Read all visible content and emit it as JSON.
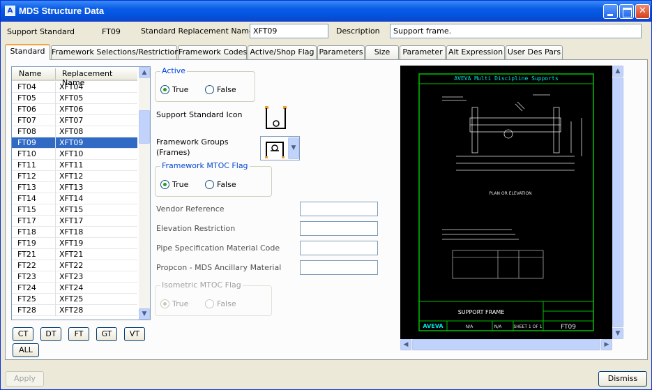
{
  "window": {
    "title": "MDS Structure Data"
  },
  "header": {
    "support_standard_label": "Support Standard",
    "support_standard_value": "FT09",
    "replacement_name_label": "Standard Replacement Name",
    "replacement_name_value": "XFT09",
    "description_label": "Description",
    "description_value": "Support frame."
  },
  "tabs": [
    "Standard",
    "Framework Selections/Restrictions",
    "Framework Codes",
    "Active/Shop Flag",
    "Parameters",
    "Size",
    "Parameter",
    "Alt Expression",
    "User Des Pars"
  ],
  "list": {
    "col_name": "Name",
    "col_replacement": "Replacement Name",
    "rows": [
      {
        "name": "FT04",
        "rep": "XFT04"
      },
      {
        "name": "FT05",
        "rep": "XFT05"
      },
      {
        "name": "FT06",
        "rep": "XFT06"
      },
      {
        "name": "FT07",
        "rep": "XFT07"
      },
      {
        "name": "FT08",
        "rep": "XFT08"
      },
      {
        "name": "FT09",
        "rep": "XFT09"
      },
      {
        "name": "FT10",
        "rep": "XFT10"
      },
      {
        "name": "FT11",
        "rep": "XFT11"
      },
      {
        "name": "FT12",
        "rep": "XFT12"
      },
      {
        "name": "FT13",
        "rep": "XFT13"
      },
      {
        "name": "FT14",
        "rep": "XFT14"
      },
      {
        "name": "FT15",
        "rep": "XFT15"
      },
      {
        "name": "FT17",
        "rep": "XFT17"
      },
      {
        "name": "FT18",
        "rep": "XFT18"
      },
      {
        "name": "FT19",
        "rep": "XFT19"
      },
      {
        "name": "FT21",
        "rep": "XFT21"
      },
      {
        "name": "FT22",
        "rep": "XFT22"
      },
      {
        "name": "FT23",
        "rep": "XFT23"
      },
      {
        "name": "FT24",
        "rep": "XFT24"
      },
      {
        "name": "FT25",
        "rep": "XFT25"
      },
      {
        "name": "FT28",
        "rep": "XFT28"
      }
    ]
  },
  "filter_buttons": [
    "CT",
    "DT",
    "FT",
    "GT",
    "VT",
    "ALL"
  ],
  "active": {
    "title": "Active",
    "true_label": "True",
    "false_label": "False"
  },
  "icon_label": "Support Standard Icon",
  "framework_groups_label": "Framework Groups\n(Frames)",
  "mtoc": {
    "title": "Framework MTOC Flag",
    "true_label": "True",
    "false_label": "False"
  },
  "fields": {
    "vendor": "Vendor Reference",
    "elevation": "Elevation Restriction",
    "pipe_spec": "Pipe Specification Material Code",
    "propcon": "Propcon - MDS Ancillary Material"
  },
  "iso": {
    "title": "Isometric MTOC Flag",
    "true_label": "True",
    "false_label": "False"
  },
  "drawing": {
    "banner": "AVEVA Multi Discipline Supports",
    "view_title": "PLAN OR ELEVATION",
    "title_block": "SUPPORT FRAME",
    "logo": "AVEVA",
    "na1": "N/A",
    "na2": "N/A",
    "sheet": "SHEET 1 OF 1",
    "code": "FT09"
  },
  "footer": {
    "apply": "Apply",
    "dismiss": "Dismiss"
  }
}
